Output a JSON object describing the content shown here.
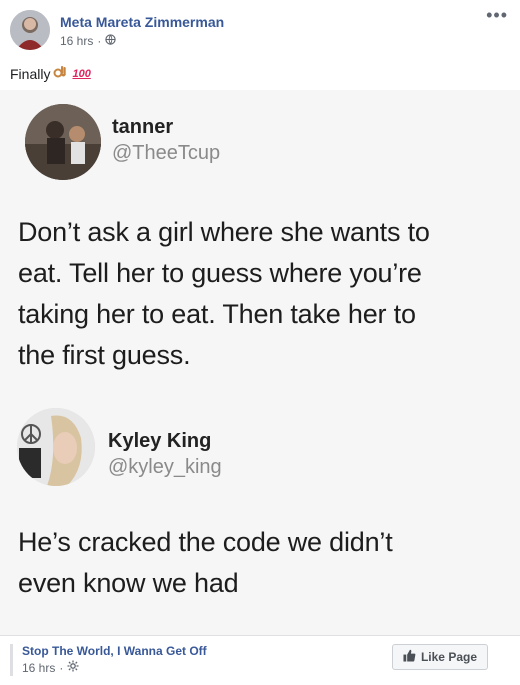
{
  "post": {
    "author": "Meta Mareta Zimmerman",
    "time": "16 hrs",
    "dot": "·",
    "caption": "Finally",
    "emoji_hundred": "100",
    "privacy_icon": "globe-icon",
    "more_icon": "more-options-icon"
  },
  "image": {
    "tweet": {
      "name": "tanner",
      "handle": "@TheeTcup",
      "text_lines": [
        "Don’t ask a girl where she wants to",
        "eat. Tell her to guess where you’re",
        "taking her to eat. Then take her to",
        "the first guess."
      ]
    },
    "reply": {
      "name": "Kyley King",
      "handle": "@kyley_king",
      "text_lines": [
        "He’s cracked the code we didn’t",
        "even know we had"
      ]
    }
  },
  "footer": {
    "page_name": "Stop The World, I Wanna Get Off",
    "time": "16 hrs",
    "dot": "·",
    "like_label": "Like Page",
    "privacy_icon": "gear-icon"
  },
  "colors": {
    "link": "#385898",
    "meta": "#606770",
    "image_bg": "#f6f6f6"
  }
}
